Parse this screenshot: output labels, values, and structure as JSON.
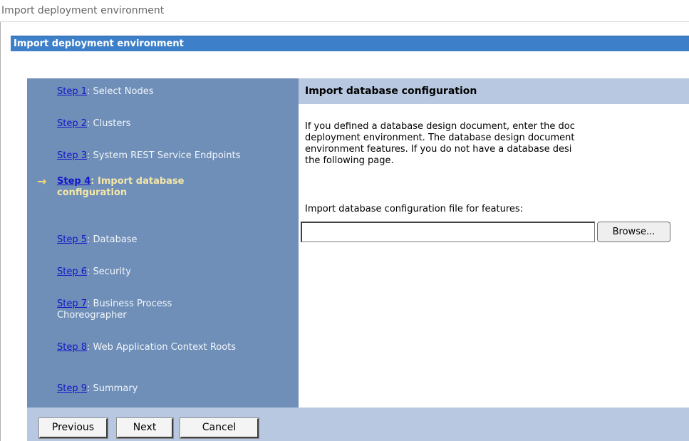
{
  "breadcrumb": "Import deployment environment",
  "portlet_title": "Import deployment environment",
  "steps": [
    {
      "link": "Step 1",
      "label": ": Select Nodes"
    },
    {
      "link": "Step 2",
      "label": ": Clusters"
    },
    {
      "link": "Step 3",
      "label": ": System REST Service Endpoints"
    },
    {
      "link": "Step 4",
      "label": ": Import database configuration"
    },
    {
      "link": "Step 5",
      "label": ": Database"
    },
    {
      "link": "Step 6",
      "label": ": Security"
    },
    {
      "link": "Step 7",
      "label": ": Business Process Choreographer"
    },
    {
      "link": "Step 8",
      "label": ": Web Application Context Roots"
    },
    {
      "link": "Step 9",
      "label": ": Summary"
    }
  ],
  "current_arrow": "→",
  "content": {
    "header": "Import database configuration",
    "body_lines": [
      "If you defined a database design document, enter the doc",
      "deployment environment. The database design document",
      "environment features. If you do not have a database desi",
      "the following page."
    ],
    "field_label": "Import database configuration file for features:",
    "file_value": "",
    "browse_label": "Browse..."
  },
  "footer": {
    "previous_label": "Previous",
    "next_label": "Next",
    "cancel_label": "Cancel"
  }
}
